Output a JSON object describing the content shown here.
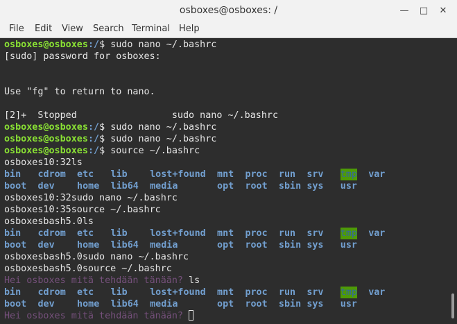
{
  "window": {
    "title": "osboxes@osboxes: /",
    "minimize_glyph": "—",
    "maximize_glyph": "□",
    "close_glyph": "✕"
  },
  "menu": [
    "File",
    "Edit",
    "View",
    "Search",
    "Terminal",
    "Help"
  ],
  "terminal": {
    "lines": [
      {
        "kind": "prompt",
        "user": "osboxes@osboxes",
        "path": ":/",
        "sym": "$ ",
        "cmd": "sudo nano ~/.bashrc"
      },
      {
        "kind": "text",
        "text": "[sudo] password for osboxes:"
      },
      {
        "kind": "text",
        "text": ""
      },
      {
        "kind": "text",
        "text": ""
      },
      {
        "kind": "text",
        "text": "Use \"fg\" to return to nano."
      },
      {
        "kind": "text",
        "text": ""
      },
      {
        "kind": "text",
        "text": "[2]+  Stopped                 sudo nano ~/.bashrc"
      },
      {
        "kind": "prompt",
        "user": "osboxes@osboxes",
        "path": ":/",
        "sym": "$ ",
        "cmd": "sudo nano ~/.bashrc"
      },
      {
        "kind": "prompt",
        "user": "osboxes@osboxes",
        "path": ":/",
        "sym": "$ ",
        "cmd": "sudo nano ~/.bashrc"
      },
      {
        "kind": "prompt",
        "user": "osboxes@osboxes",
        "path": ":/",
        "sym": "$ ",
        "cmd": "source ~/.bashrc"
      },
      {
        "kind": "text",
        "text": "osboxes10:32ls"
      },
      {
        "kind": "ls1"
      },
      {
        "kind": "ls2"
      },
      {
        "kind": "text",
        "text": "osboxes10:32sudo nano ~/.bashrc"
      },
      {
        "kind": "text",
        "text": "osboxes10:35source ~/.bashrc"
      },
      {
        "kind": "text",
        "text": "osboxesbash5.0ls"
      },
      {
        "kind": "ls1"
      },
      {
        "kind": "ls2"
      },
      {
        "kind": "text",
        "text": "osboxesbash5.0sudo nano ~/.bashrc"
      },
      {
        "kind": "text",
        "text": "osboxesbash5.0source ~/.bashrc"
      },
      {
        "kind": "ps1",
        "prompt": "Hei osboxes mitä tehdään tänään? ",
        "cmd": "ls"
      },
      {
        "kind": "ls1"
      },
      {
        "kind": "ls2"
      },
      {
        "kind": "ps1",
        "prompt": "Hei osboxes mitä tehdään tänään? ",
        "cmd": "",
        "cursor": true
      }
    ],
    "ls_row1": [
      "bin",
      "cdrom",
      "etc",
      "lib",
      "lost+found",
      "mnt",
      "proc",
      "run",
      "srv",
      "tmp",
      "var"
    ],
    "ls_row2": [
      "boot",
      "dev",
      "home",
      "lib64",
      "media",
      "opt",
      "root",
      "sbin",
      "sys",
      "usr"
    ],
    "highlight_dir": "tmp"
  },
  "colors": {
    "background": "#2d2d2d",
    "prompt_user": "#8ae234",
    "prompt_path": "#729fcf",
    "directory": "#729fcf",
    "custom_prompt": "#75507b",
    "sticky_dir_bg": "#4e9a06"
  }
}
